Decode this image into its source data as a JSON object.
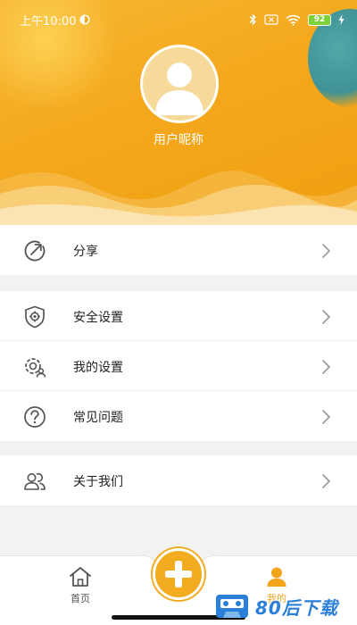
{
  "status_bar": {
    "time": "上午10:00",
    "battery_level": "92"
  },
  "profile": {
    "nickname": "用户昵称"
  },
  "menu": {
    "share": {
      "label": "分享",
      "icon": "share-icon"
    },
    "settings_group": [
      {
        "label": "安全设置",
        "icon": "shield-gear-icon"
      },
      {
        "label": "我的设置",
        "icon": "user-gear-icon"
      },
      {
        "label": "常见问题",
        "icon": "question-icon"
      }
    ],
    "about": {
      "label": "关于我们",
      "icon": "users-icon"
    }
  },
  "bottom_nav": {
    "home_label": "首页",
    "mine_label": "我的",
    "active_color": "#f2a51a"
  },
  "colors": {
    "header": "#f4a81d",
    "accent": "#f3ac1f"
  },
  "watermark": {
    "text": "80后下载"
  }
}
